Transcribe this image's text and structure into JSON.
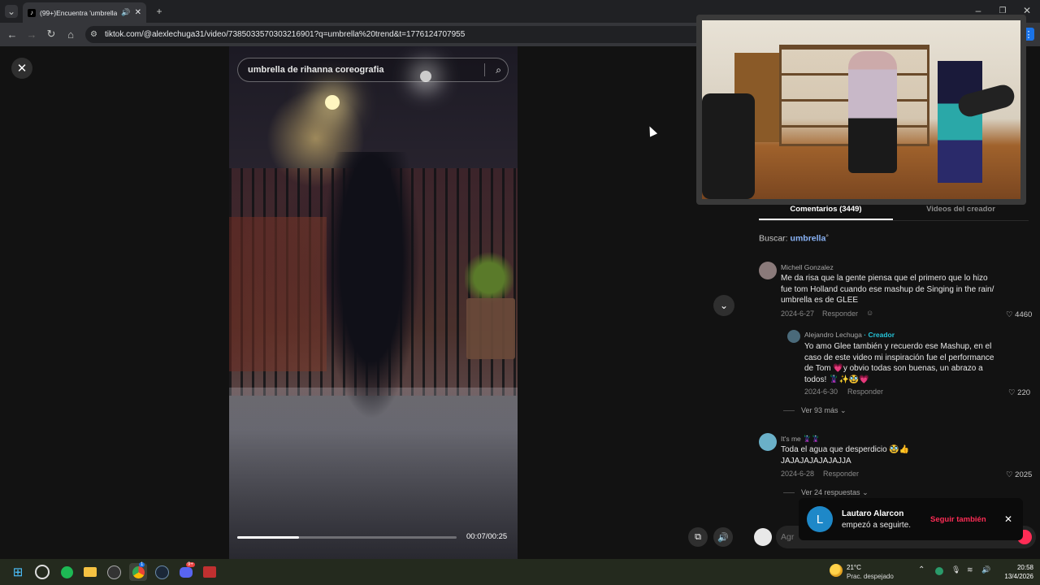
{
  "browser": {
    "tab_title": "(99+)Encuentra 'umbrella t",
    "tab_favicon": "♪",
    "url": "tiktok.com/@alexlechuga31/video/7385033570303216901?q=umbrella%20trend&t=1776124707955"
  },
  "video": {
    "search_text": "umbrella de rihanna coreografia",
    "time": "00:07/00:25",
    "progress": 0.28
  },
  "tabs": {
    "comments": "Comentarios (3449)",
    "creator_videos": "Videos del creador"
  },
  "search_hint": {
    "label": "Buscar:",
    "term": "umbrella"
  },
  "comments": [
    {
      "name": "Michell Gonzalez",
      "text": "Me da risa que la gente piensa que el primero que lo hizo fue tom Holland cuando ese mashup de Singing in the rain/ umbrella es de GLEE",
      "date": "2024-6-27",
      "reply": "Responder",
      "likes": "4460",
      "avatar_color": "#8a7a7a"
    },
    {
      "name": "Alejandro Lechuga",
      "badge": "· Creador",
      "text": "Yo amo Glee también y recuerdo ese Mashup, en el caso de este video mi inspiración fue el performance de Tom 💗y obvio todas son buenas, un abrazo a todos! 🦹✨🥸💗",
      "date": "2024-6-30",
      "reply": "Responder",
      "likes": "220",
      "more": "Ver 93 más",
      "avatar_color": "#4a6a7a"
    },
    {
      "name": "It's me 🦹🦹",
      "text": "Toda el agua que desperdicio 🥸👍 JAJAJAJAJAJAJJA",
      "date": "2024-6-28",
      "reply": "Responder",
      "likes": "2025",
      "more": "Ver 24 respuestas",
      "avatar_color": "#6ab0c8"
    }
  ],
  "add_comment_placeholder": "Agr",
  "notification": {
    "initial": "L",
    "name": "Lautaro Alarcon",
    "message": "empezó a seguirte.",
    "action": "Seguir también"
  },
  "taskbar": {
    "weather_temp": "21°C",
    "weather_desc": "Prac. despejado",
    "time": "20:58",
    "date": "13/4/2026",
    "badge1": "1",
    "badge2": "9+"
  },
  "colors": {
    "accent_creator": "#25c2d6",
    "follow_red": "#fe2c55",
    "search_term": "#8ab4f8"
  }
}
